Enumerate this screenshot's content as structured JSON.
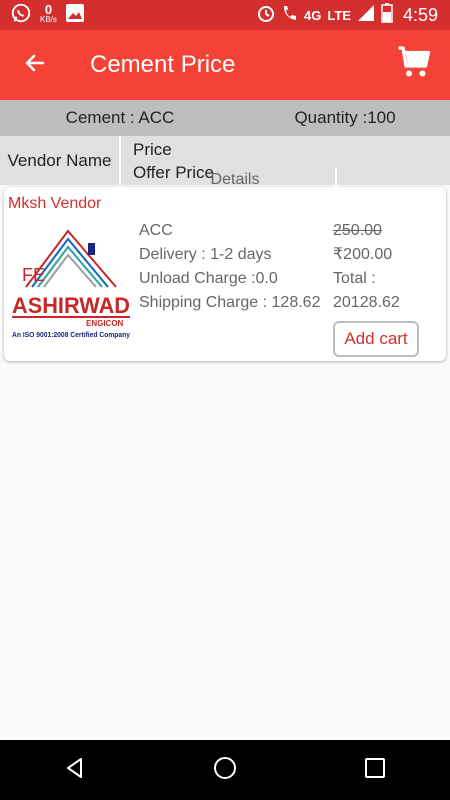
{
  "status_bar": {
    "data_speed": "0",
    "data_unit": "KB/s",
    "network": "4G",
    "lte": "LTE",
    "time": "4:59"
  },
  "app_bar": {
    "title": "Cement Price",
    "back_icon": "arrow-back-icon",
    "cart_icon": "shopping-cart-icon"
  },
  "summary": {
    "cement": "Cement : ACC",
    "quantity": "Quantity :100"
  },
  "table_header": {
    "vendor": "Vendor Name",
    "details": "Details",
    "price": "Price",
    "offer_price": "Offer Price"
  },
  "vendors": [
    {
      "name": "Mksh Vendor",
      "logo_text": "ASHIRWAD",
      "logo_sub": "ENGICON",
      "logo_cert": "An ISO 9001:2008 Certified Company",
      "logo_fe": "FE",
      "brand": "ACC",
      "delivery": "Delivery : 1-2 days",
      "unload": "Unload Charge :0.0",
      "shipping": "Shipping Charge : 128.62",
      "price": "250.00",
      "offer_price": "₹200.00",
      "total_label": "Total :",
      "total": "20128.62",
      "add_cart": "Add cart"
    }
  ],
  "colors": {
    "status_bar": "#d32f2f",
    "app_bar": "#f44336",
    "accent_red": "#d32f2f"
  }
}
